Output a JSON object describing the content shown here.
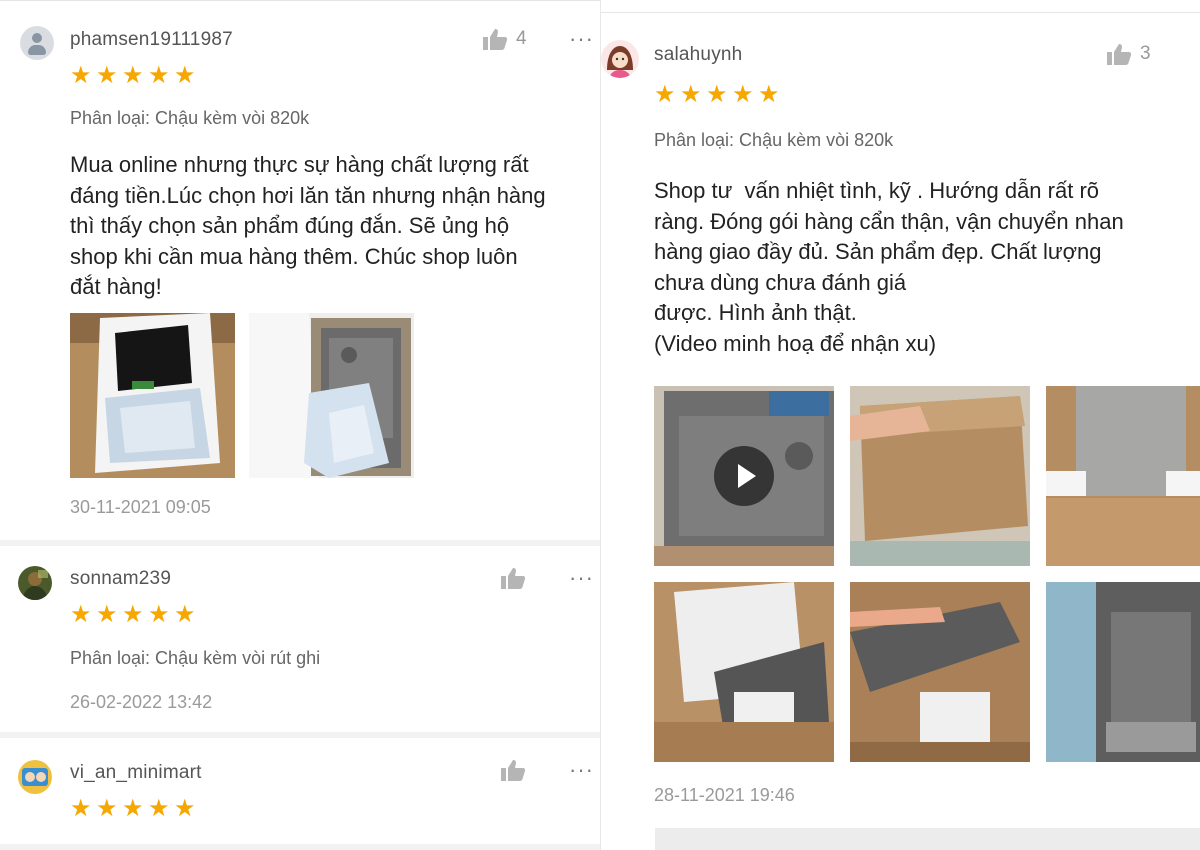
{
  "left_reviews": [
    {
      "username": "phamsen19111987",
      "rating": 5,
      "likes": "4",
      "variant": "Phân loại: Chậu kèm vòi 820k",
      "comment": "Mua online nhưng thực sự hàng chất lượng rất\nđáng tiền.Lúc chọn hơi lăn tăn nhưng nhận hàng\nthì thấy chọn sản phẩm đúng đắn. Sẽ ủng hộ\nshop khi cần mua hàng thêm. Chúc shop luôn\nđắt hàng!",
      "timestamp": "30-11-2021 09:05"
    },
    {
      "username": "sonnam239",
      "rating": 5,
      "likes": "",
      "variant": "Phân loại: Chậu kèm vòi rút ghi",
      "timestamp": "26-02-2022 13:42"
    },
    {
      "username": "vi_an_minimart",
      "rating": 5,
      "likes": ""
    }
  ],
  "right_review": {
    "username": "salahuynh",
    "rating": 5,
    "likes": "3",
    "variant": "Phân loại: Chậu kèm vòi 820k",
    "comment": "Shop tư  vấn nhiệt tình, kỹ . Hướng dẫn rất rõ\nràng. Đóng gói hàng cẩn thận, vận chuyển nhan\nhàng giao đầy đủ. Sản phẩm đẹp. Chất lượng\nchưa dùng chưa đánh giá\nđược. Hình ảnh thật.\n(Video minh hoạ để nhận xu)",
    "timestamp": "28-11-2021 19:46"
  },
  "icons": {
    "star": "star-icon",
    "like": "thumbs-up-icon",
    "more": "more-options-icon",
    "play": "play-icon"
  },
  "colors": {
    "star": "#f6a700",
    "text_muted": "#9a9a9a",
    "separator": "#f2f2f2"
  }
}
